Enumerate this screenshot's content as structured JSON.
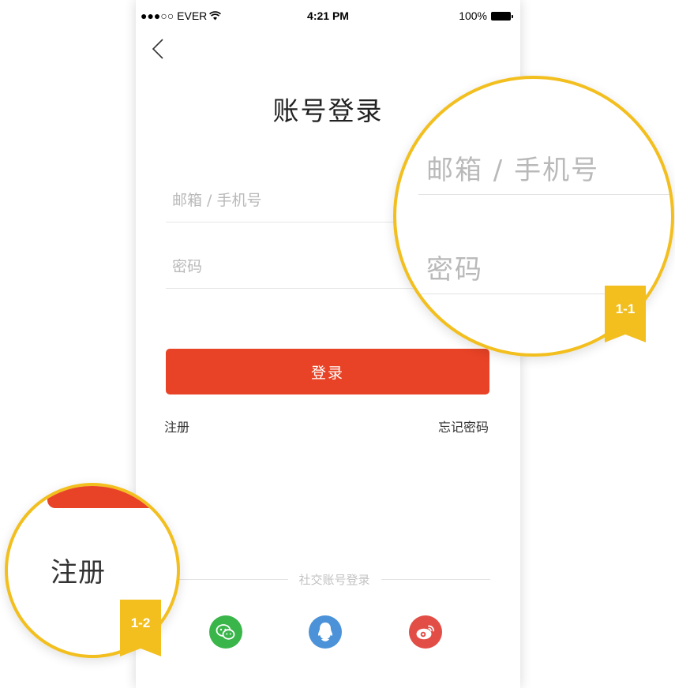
{
  "status_bar": {
    "carrier": "●●●○○ EVER",
    "time": "4:21 PM",
    "battery": "100%"
  },
  "page": {
    "title": "账号登录"
  },
  "form": {
    "email_placeholder": "邮箱 / 手机号",
    "password_placeholder": "密码",
    "login_label": "登录"
  },
  "links": {
    "register": "注册",
    "forgot_password": "忘记密码"
  },
  "social": {
    "divider_label": "社交账号登录",
    "icons": [
      "wechat-icon",
      "qq-icon",
      "weibo-icon"
    ]
  },
  "callouts": {
    "zoom_1": {
      "email_placeholder": "邮箱 / 手机号",
      "password_placeholder": "密码",
      "badge": "1-1"
    },
    "zoom_2": {
      "register": "注册",
      "badge": "1-2"
    }
  },
  "colors": {
    "primary": "#e84326",
    "callout": "#f2bf1e",
    "wechat": "#39b54a",
    "qq": "#4b92d8",
    "weibo": "#e24d46"
  }
}
